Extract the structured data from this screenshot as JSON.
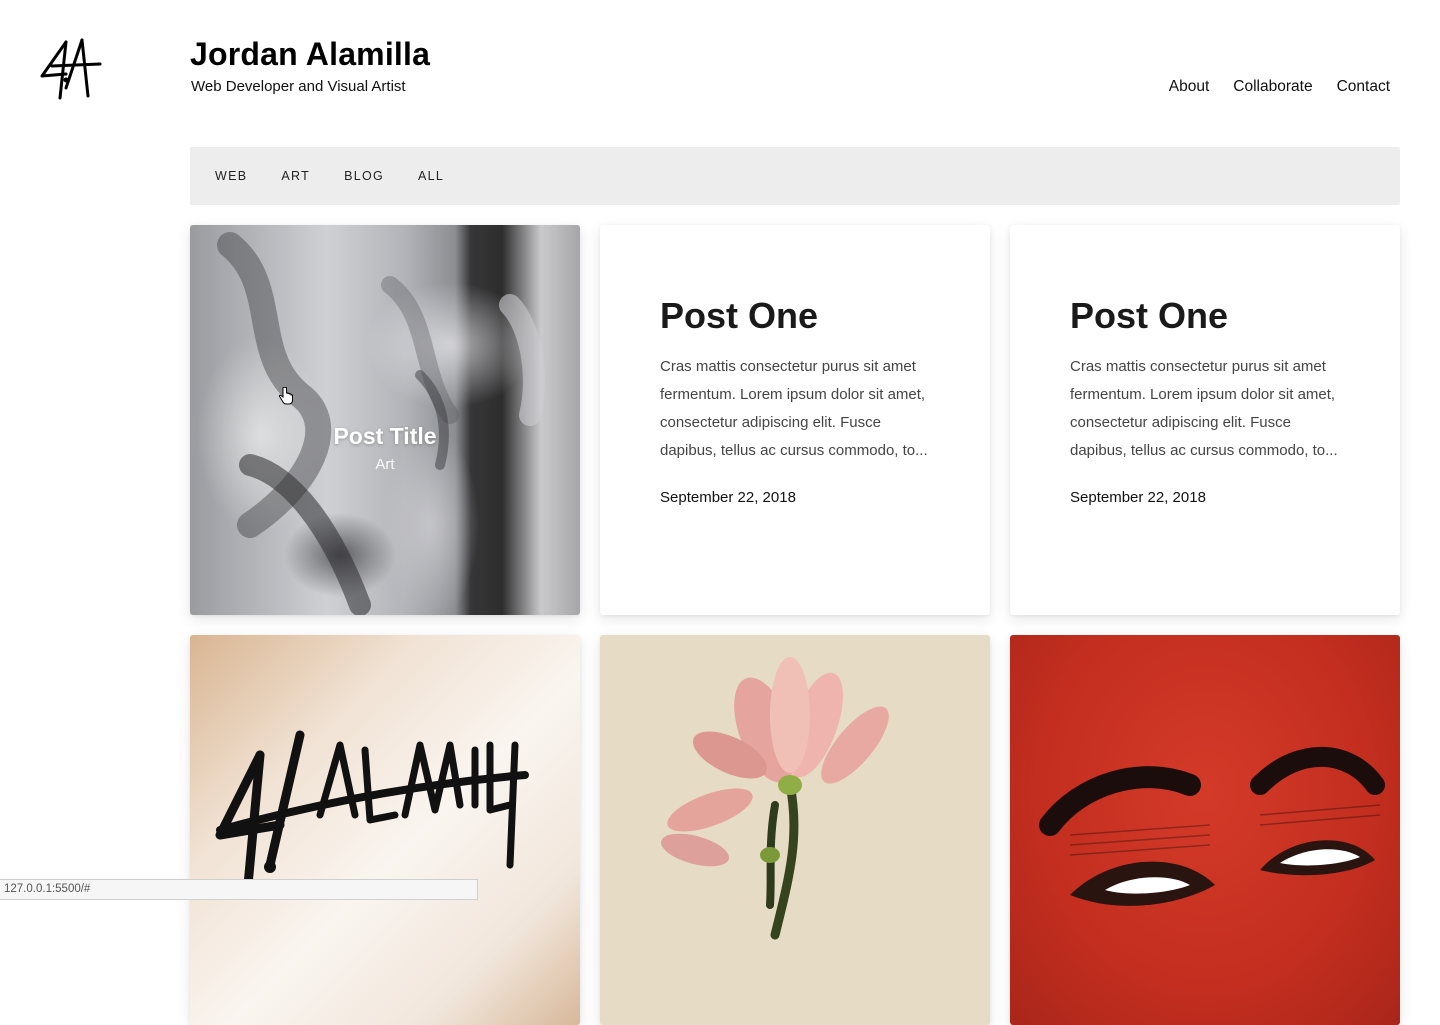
{
  "header": {
    "title": "Jordan Alamilla",
    "subtitle": "Web Developer and Visual Artist",
    "logo_icon": "signature-logo-icon"
  },
  "nav": {
    "items": [
      "About",
      "Collaborate",
      "Contact"
    ]
  },
  "filters": {
    "items": [
      "WEB",
      "ART",
      "BLOG",
      "ALL"
    ]
  },
  "cards": [
    {
      "type": "image",
      "overlay_title": "Post Title",
      "overlay_subtitle": "Art",
      "image": "grayscale-figure-painting"
    },
    {
      "type": "text",
      "title": "Post One",
      "excerpt": "Cras mattis consectetur purus sit amet fermentum. Lorem ipsum dolor sit amet, consectetur adipiscing elit. Fusce dapibus, tellus ac cursus commodo, to...",
      "date": "September 22, 2018"
    },
    {
      "type": "text",
      "title": "Post One",
      "excerpt": "Cras mattis consectetur purus sit amet fermentum. Lorem ipsum dolor sit amet, consectetur adipiscing elit. Fusce dapibus, tellus ac cursus commodo, to...",
      "date": "September 22, 2018"
    },
    {
      "type": "image",
      "image": "alamilla-signature-artwork"
    },
    {
      "type": "image",
      "image": "pink-magnolia-flower"
    },
    {
      "type": "image",
      "image": "red-eyes-illustration"
    }
  ],
  "status_bar": {
    "url": "127.0.0.1:5500/#"
  },
  "colors": {
    "filter_bar_bg": "#ededed",
    "red_artwork": "#c32e1f",
    "flower_bg": "#e6dcc6"
  }
}
